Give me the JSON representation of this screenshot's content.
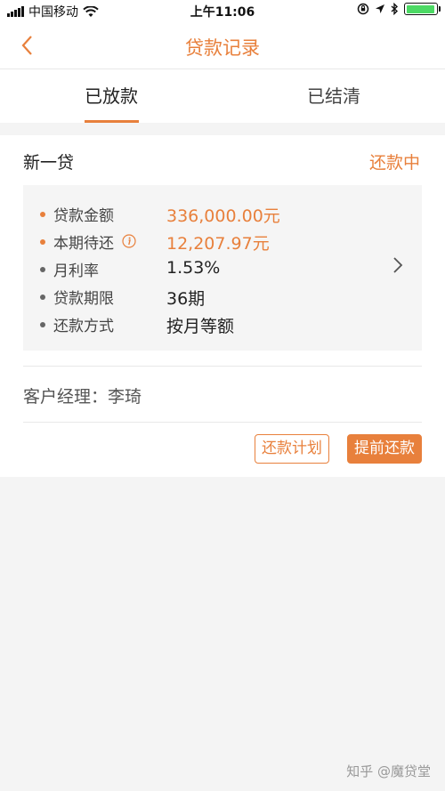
{
  "status_bar": {
    "carrier": "中国移动",
    "time": "上午11:06"
  },
  "nav": {
    "title": "贷款记录"
  },
  "tabs": [
    {
      "label": "已放款",
      "active": true
    },
    {
      "label": "已结清",
      "active": false
    }
  ],
  "loan": {
    "name": "新一贷",
    "status": "还款中",
    "rows": [
      {
        "label": "贷款金额",
        "value": "336,000.00元"
      },
      {
        "label": "本期待还",
        "value": "12,207.97元"
      },
      {
        "label": "月利率",
        "value": "1.53%"
      },
      {
        "label": "贷款期限",
        "value": "36期"
      },
      {
        "label": "还款方式",
        "value": "按月等额"
      }
    ],
    "manager": {
      "label": "客户经理：",
      "name": "李琦"
    },
    "buttons": {
      "plan": "还款计划",
      "prepay": "提前还款"
    }
  },
  "watermark": "知乎 @魔贷堂",
  "colors": {
    "accent": "#e8803c",
    "battery": "#4cd964"
  }
}
